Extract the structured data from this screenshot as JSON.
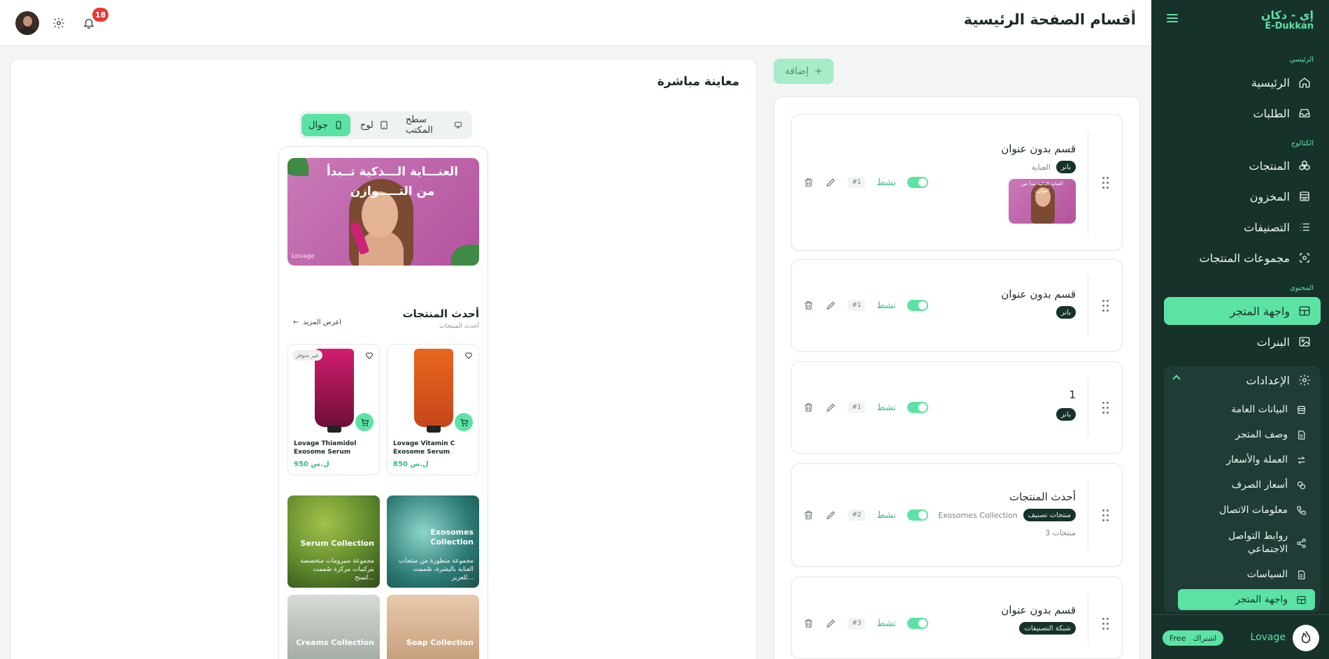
{
  "sidebar": {
    "brand_ar": "إي - دكان",
    "brand_en": "E-Dukkan",
    "groups": {
      "main": "الرئيسي",
      "catalog": "الكتالوج",
      "content": "المحتوى"
    },
    "items": {
      "home": "الرئيسية",
      "orders": "الطلبات",
      "products": "المنتجات",
      "inventory": "المخزون",
      "categories": "التصنيفات",
      "collections": "مجموعات المنتجات",
      "storefront": "واجهة المتجر",
      "banners": "البنرات"
    },
    "settings": {
      "label": "الإعدادات",
      "items": {
        "general": "البيانات العامة",
        "description": "وصف المتجر",
        "currency": "العملة والأسعار",
        "exchange": "أسعار الصرف",
        "contact": "معلومات الاتصال",
        "social": "روابط التواصل الاجتماعي",
        "policies": "السياسات",
        "storefront": "واجهة المتجر"
      }
    },
    "store": {
      "name": "Lovage",
      "plan_label": "اشتراك",
      "plan_value": "Free"
    }
  },
  "topbar": {
    "title": "أقسام الصفحة الرئيسية",
    "notification_count": "18"
  },
  "preview": {
    "title": "معاينة مباشرة",
    "devices": {
      "desktop": "سطح المكتب",
      "tablet": "لوح",
      "mobile": "جوال"
    },
    "hero": {
      "text": "العنـــاية الـــذكية تــبدأ من التـــــوازن",
      "brand": "Lovage"
    },
    "latest": {
      "title": "أحدث المنتجات",
      "subtitle": "أحدث المنتجات",
      "view_more": "اعرض المزيد"
    },
    "products": [
      {
        "name": "Lovage Vitamin C Exosome Serum",
        "price": "850 ل.س",
        "out_of_stock": ""
      },
      {
        "name": "Lovage Thiamidol Exosome Serum",
        "price": "950 ل.س",
        "out_of_stock": "غير متوفر"
      }
    ],
    "collections": [
      {
        "name": "Exosomes Collection",
        "desc": "مجموعة متطورة من منتجات العناية بالبشرة، صُممت للعزيز..."
      },
      {
        "name": "Serum Collection",
        "desc": "مجموعة سيرومات متخصصة بتركيبات مركزة صُممت لتمنح..."
      },
      {
        "name": "Soap Collection",
        "desc": ""
      },
      {
        "name": "Creams Collection",
        "desc": ""
      }
    ]
  },
  "sections": {
    "add_label": "إضافة",
    "active_label": "نشط",
    "list": [
      {
        "title": "قسم بدون عنوان",
        "type": "بانر",
        "meta": "العناية",
        "order": "#1",
        "count": ""
      },
      {
        "title": "قسم بدون عنوان",
        "type": "بانر",
        "meta": "",
        "order": "#1",
        "count": ""
      },
      {
        "title": "1",
        "type": "بانر",
        "meta": "",
        "order": "#1",
        "count": ""
      },
      {
        "title": "أحدث المنتجات",
        "type": "منتجات تصنيف",
        "meta": "Exosomes Collection",
        "order": "#2",
        "count": "3 منتجات"
      },
      {
        "title": "قسم بدون عنوان",
        "type": "شبكة التصنيفات",
        "meta": "",
        "order": "#3",
        "count": ""
      }
    ],
    "thumb_text": "العناية الذكية تبدأ من التوازن"
  },
  "colors": {
    "accent": "#5ce3a4",
    "sidebar_bg": "#17312b",
    "notification": "#e53935"
  }
}
